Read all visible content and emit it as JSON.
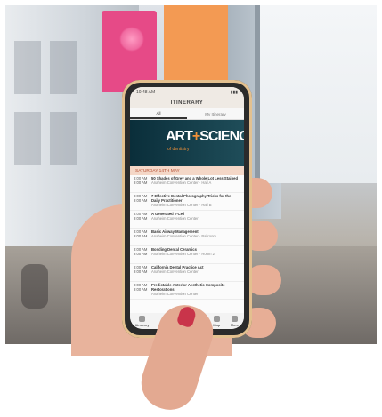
{
  "app": {
    "status_time": "10:48 AM",
    "title": "ITINERARY",
    "tabs": [
      "All",
      "My Itinerary"
    ]
  },
  "hero": {
    "text_part1": "ART",
    "text_plus": "+",
    "text_part2": "SCIENCE",
    "sub": "of dentistry"
  },
  "day_header": "SATURDAY 14TH MAY",
  "sessions": [
    {
      "time": "8:00 AM",
      "end": "9:00 AM",
      "title": "50 Shades of Grey and a Whole Lot Less Stained",
      "meta": "Anaheim Convention Center · Hall A"
    },
    {
      "time": "8:00 AM",
      "end": "9:00 AM",
      "title": "7 Effective Dental Photography Tricks for the Daily Practitioner",
      "meta": "Anaheim Convention Center · Hall B"
    },
    {
      "time": "8:00 AM",
      "end": "9:00 AM",
      "title": "A Generated T-Cell",
      "meta": "Anaheim Convention Center"
    },
    {
      "time": "8:00 AM",
      "end": "9:00 AM",
      "title": "Basic Airway Management",
      "meta": "Anaheim Convention Center · Ballroom"
    },
    {
      "time": "8:00 AM",
      "end": "9:00 AM",
      "title": "Bonding Dental Ceramics",
      "meta": "Anaheim Convention Center · Room 2"
    },
    {
      "time": "8:00 AM",
      "end": "9:00 AM",
      "title": "California Dental Practice Act",
      "meta": "Anaheim Convention Center"
    },
    {
      "time": "8:00 AM",
      "end": "9:00 AM",
      "title": "Predictable Anterior Aesthetic Composite Restorations",
      "meta": "Anaheim Convention Center"
    }
  ],
  "bottom_nav": [
    "Itinerary",
    "Exhibitors",
    "Speakers",
    "Map",
    "More"
  ],
  "colors": {
    "hero_bg": "#0a2e3a",
    "accent_orange": "#f09038",
    "day_bg": "#f4d7c7",
    "banner_pink": "#e64a87"
  }
}
